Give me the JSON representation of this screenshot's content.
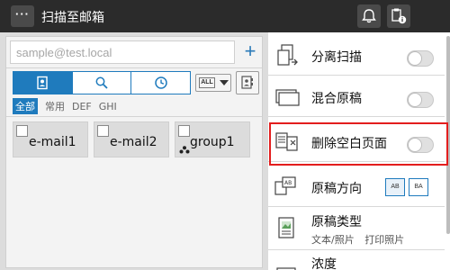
{
  "topbar": {
    "menu_label": "···",
    "title": "扫描至邮箱"
  },
  "left": {
    "address_placeholder": "sample@test.local",
    "add_label": "+",
    "tabs": [
      {
        "icon": "address-book-icon",
        "active": true
      },
      {
        "icon": "search-icon",
        "active": false
      },
      {
        "icon": "clock-icon",
        "active": false
      }
    ],
    "filter_all": "ALL",
    "filters": [
      "全部",
      "常用",
      "DEF",
      "GHI"
    ],
    "cards": [
      {
        "label": "e-mail1",
        "group": false
      },
      {
        "label": "e-mail2",
        "group": false
      },
      {
        "label": "group1",
        "group": true
      }
    ]
  },
  "right": {
    "rows": [
      {
        "label": "分离扫描",
        "toggle": false
      },
      {
        "label": "混合原稿",
        "toggle": false
      },
      {
        "label": "删除空白页面",
        "toggle": false,
        "highlighted": true
      },
      {
        "label": "原稿方向",
        "options": [
          "AB",
          "BA"
        ]
      },
      {
        "label": "原稿类型",
        "sub": [
          "文本/照片",
          "打印照片"
        ]
      },
      {
        "label": "浓度"
      }
    ]
  },
  "colors": {
    "accent": "#1f7bbd",
    "highlight": "#e31d1d",
    "topbar_bg": "#2b2b2b"
  }
}
